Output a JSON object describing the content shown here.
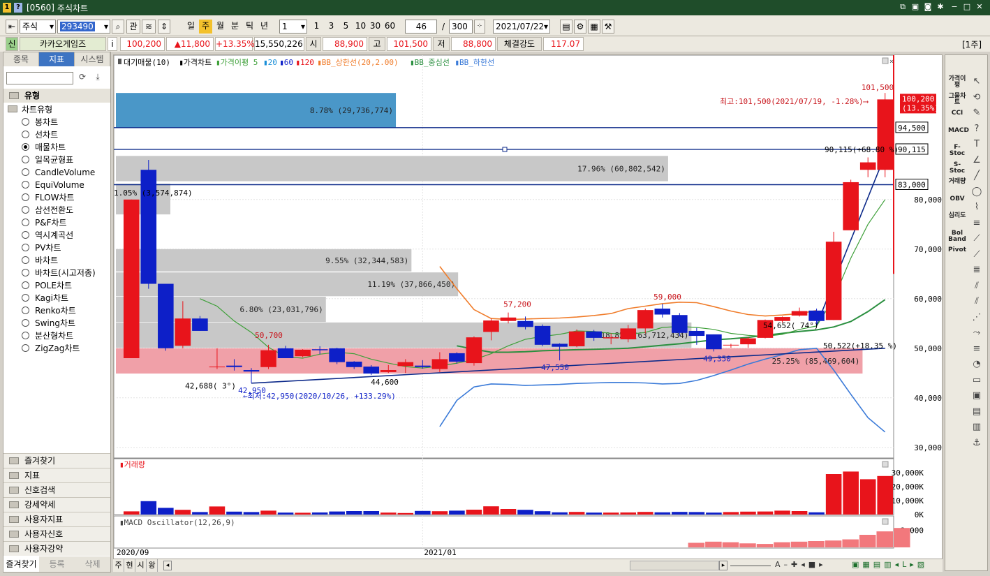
{
  "window": {
    "code": "[0560]",
    "title": "주식차트",
    "icon1": "1",
    "icon2": "?"
  },
  "toolbar": {
    "market": "주식",
    "code": "293490",
    "btn_gwan": "관",
    "periods": [
      "일",
      "주",
      "월",
      "분",
      "틱",
      "년"
    ],
    "active_period": "주",
    "interval": "1",
    "quick": [
      "1",
      "3",
      "5",
      "10",
      "30",
      "60"
    ],
    "count": "46",
    "total": "300",
    "date": "2021/07/22"
  },
  "infobar": {
    "badge": "신",
    "name": "카카오게임즈",
    "i": "i",
    "price": "100,200",
    "change": "▲11,800",
    "rate": "+13.35%",
    "volume": "15,550,226",
    "open_label": "시",
    "open": "88,900",
    "high_label": "고",
    "high": "101,500",
    "low_label": "저",
    "low": "88,800",
    "strength_label": "체결강도",
    "strength": "117.07",
    "unit": "[1주]"
  },
  "left": {
    "tabs": [
      "종목",
      "지표",
      "시스템"
    ],
    "active_tab": "지표",
    "section": "유형",
    "tree_root": "차트유형",
    "items": [
      "봉차트",
      "선차트",
      "매물차트",
      "일목균형표",
      "CandleVolume",
      "EquiVolume",
      "FLOW차트",
      "삼선전환도",
      "P&F차트",
      "역시계곡선",
      "PV차트",
      "바차트",
      "바차트(시고저종)",
      "POLE차트",
      "Kagi차트",
      "Renko차트",
      "Swing차트",
      "분산형차트",
      "ZigZag차트"
    ],
    "selected": "매물차트",
    "menus": [
      "즐겨찾기",
      "지표",
      "신호검색",
      "강세약세",
      "사용자지표",
      "사용자신호",
      "사용자강약"
    ],
    "bottom_tabs": [
      "즐겨찾기",
      "등록",
      "삭제"
    ]
  },
  "right_tools": [
    "가격이평",
    "그물차트",
    "CCI",
    "MACD",
    "F-Stoc",
    "S-Stoc",
    "거래량",
    "OBV",
    "심리도",
    "Bol Band",
    "Pivot"
  ],
  "bottom": {
    "tabs": [
      "주",
      "현",
      "시",
      "왕"
    ]
  },
  "colors": {
    "up": "#e8141b",
    "down": "#0d1fc8",
    "ma5": "#3fa03a",
    "ma20": "#2a8f3f",
    "bb_upper": "#f07c2a",
    "bb_lower": "#3a7ad8",
    "trend": "#0d2a8a"
  },
  "chart_data": {
    "type": "candlestick",
    "legend": [
      {
        "label": "대기매물(10)",
        "color": "#000"
      },
      {
        "label": "가격차트",
        "color": "#000"
      },
      {
        "label": "가격이평 5",
        "color": "#3fa03a"
      },
      {
        "label": "20",
        "color": "#1a8fd8"
      },
      {
        "label": "60",
        "color": "#0d1fc8"
      },
      {
        "label": "120",
        "color": "#e8141b"
      },
      {
        "label": "BB_상한선(20,2.00)",
        "color": "#f07c2a"
      },
      {
        "label": "BB_중심선",
        "color": "#2a8f3f"
      },
      {
        "label": "BB_하한선",
        "color": "#3a7ad8"
      }
    ],
    "y_ticks": [
      "80,000",
      "70,000",
      "60,000",
      "50,000",
      "40,000",
      "30,000"
    ],
    "y_tick_values": [
      80000,
      70000,
      60000,
      50000,
      40000,
      30000
    ],
    "ylim": [
      28000,
      108000
    ],
    "x_labels": [
      "2020/09",
      "2021/01"
    ],
    "candles": [
      {
        "o": 48000,
        "h": 80000,
        "l": 48000,
        "c": 80000
      },
      {
        "o": 86000,
        "h": 88000,
        "l": 62000,
        "c": 63000
      },
      {
        "o": 63000,
        "h": 63000,
        "l": 49500,
        "c": 50000
      },
      {
        "o": 50500,
        "h": 59500,
        "l": 50000,
        "c": 56000
      },
      {
        "o": 56000,
        "h": 56500,
        "l": 53500,
        "c": 53500
      },
      {
        "o": 46200,
        "h": 50000,
        "l": 45800,
        "c": 46300
      },
      {
        "o": 46500,
        "h": 47800,
        "l": 45500,
        "c": 46200
      },
      {
        "o": 45600,
        "h": 46000,
        "l": 43000,
        "c": 45300
      },
      {
        "o": 46200,
        "h": 50700,
        "l": 45800,
        "c": 49600
      },
      {
        "o": 50000,
        "h": 50500,
        "l": 48000,
        "c": 48000
      },
      {
        "o": 48400,
        "h": 49800,
        "l": 48200,
        "c": 49700
      },
      {
        "o": 49800,
        "h": 50400,
        "l": 48800,
        "c": 49600
      },
      {
        "o": 50000,
        "h": 50100,
        "l": 46800,
        "c": 47200
      },
      {
        "o": 47300,
        "h": 47400,
        "l": 45800,
        "c": 46200
      },
      {
        "o": 46300,
        "h": 46600,
        "l": 44600,
        "c": 44900
      },
      {
        "o": 45200,
        "h": 46600,
        "l": 45000,
        "c": 45600
      },
      {
        "o": 46400,
        "h": 47800,
        "l": 45000,
        "c": 47200
      },
      {
        "o": 46500,
        "h": 47600,
        "l": 45900,
        "c": 46200
      },
      {
        "o": 45800,
        "h": 49200,
        "l": 45200,
        "c": 47800
      },
      {
        "o": 49000,
        "h": 49200,
        "l": 46900,
        "c": 47300
      },
      {
        "o": 47000,
        "h": 52400,
        "l": 46500,
        "c": 52200
      },
      {
        "o": 53300,
        "h": 56000,
        "l": 51600,
        "c": 55600
      },
      {
        "o": 55500,
        "h": 57200,
        "l": 55000,
        "c": 56200
      },
      {
        "o": 55500,
        "h": 56400,
        "l": 53800,
        "c": 54300
      },
      {
        "o": 54500,
        "h": 54800,
        "l": 50400,
        "c": 50700
      },
      {
        "o": 50900,
        "h": 51000,
        "l": 47550,
        "c": 50300
      },
      {
        "o": 50400,
        "h": 53800,
        "l": 50200,
        "c": 53400
      },
      {
        "o": 53400,
        "h": 53700,
        "l": 51500,
        "c": 52100
      },
      {
        "o": 52000,
        "h": 53000,
        "l": 50800,
        "c": 52200
      },
      {
        "o": 51800,
        "h": 54700,
        "l": 51200,
        "c": 54000
      },
      {
        "o": 54000,
        "h": 58000,
        "l": 53000,
        "c": 57700
      },
      {
        "o": 58000,
        "h": 59000,
        "l": 56200,
        "c": 56800
      },
      {
        "o": 56700,
        "h": 57100,
        "l": 52500,
        "c": 53100
      },
      {
        "o": 53500,
        "h": 54100,
        "l": 50700,
        "c": 52500
      },
      {
        "o": 52800,
        "h": 52800,
        "l": 49350,
        "c": 49800
      },
      {
        "o": 50600,
        "h": 50900,
        "l": 50100,
        "c": 50700
      },
      {
        "o": 50800,
        "h": 52300,
        "l": 50100,
        "c": 52000
      },
      {
        "o": 52100,
        "h": 55800,
        "l": 52000,
        "c": 55700
      },
      {
        "o": 55500,
        "h": 56400,
        "l": 55200,
        "c": 56300
      },
      {
        "o": 56600,
        "h": 58200,
        "l": 56400,
        "c": 57500
      },
      {
        "o": 57600,
        "h": 58000,
        "l": 54652,
        "c": 55500
      },
      {
        "o": 55700,
        "h": 73500,
        "l": 55700,
        "c": 71500
      },
      {
        "o": 73800,
        "h": 84000,
        "l": 74300,
        "c": 83500
      },
      {
        "o": 86000,
        "h": 88500,
        "l": 84500,
        "c": 87500
      },
      {
        "o": 86000,
        "h": 101500,
        "l": 84500,
        "c": 100200
      }
    ],
    "volume_ticks": [
      "30,000K",
      "20,000K",
      "10,000K",
      "0K"
    ],
    "volume_tick_values": [
      30000,
      20000,
      10000,
      0
    ],
    "volume_ylim": [
      0,
      37000
    ],
    "volume": [
      2300,
      9600,
      4800,
      3400,
      1800,
      5800,
      2100,
      1800,
      2800,
      1400,
      1300,
      1500,
      2200,
      2500,
      2500,
      1400,
      1100,
      2600,
      2400,
      2800,
      3500,
      5900,
      4000,
      3400,
      2400,
      1600,
      1900,
      1400,
      1400,
      1500,
      1900,
      1600,
      1900,
      1800,
      1400,
      1800,
      2100,
      2200,
      2800,
      2500,
      1600,
      29000,
      30800,
      25300,
      27600
    ],
    "macd_label": "MACD Oscillator(12,26,9)",
    "macd_tick": "3,000",
    "macd_tick_value": 3000,
    "macd_ylim": [
      0,
      5500
    ],
    "macd_start_index": 33,
    "macd": [
      800,
      1000,
      900,
      700,
      600,
      900,
      1000,
      1100,
      1200,
      1400,
      2200,
      2800,
      3400
    ],
    "volume_label": "거래량",
    "ma5": [
      null,
      null,
      null,
      null,
      60000,
      58500,
      55500,
      53200,
      50200,
      48300,
      48000,
      48800,
      49200,
      48900,
      47800,
      47000,
      46300,
      46000,
      46400,
      47000,
      47700,
      48900,
      50500,
      51800,
      52400,
      52800,
      53500,
      53400,
      53000,
      52800,
      53200,
      54200,
      54400,
      54200,
      53800,
      53000,
      52600,
      52400,
      52800,
      53800,
      54500,
      60000,
      68200,
      75000,
      80000
    ],
    "ma20": [
      null,
      null,
      null,
      null,
      null,
      null,
      null,
      null,
      null,
      null,
      null,
      null,
      null,
      null,
      null,
      null,
      null,
      null,
      null,
      50500,
      49800,
      49200,
      49200,
      49300,
      49500,
      49600,
      49700,
      49800,
      49900,
      50000,
      50300,
      50600,
      50900,
      51300,
      51700,
      51900,
      52200,
      52600,
      53000,
      53400,
      53700,
      54300,
      55400,
      57400,
      59800
    ],
    "bb_upper": [
      null,
      null,
      null,
      null,
      null,
      null,
      null,
      null,
      null,
      null,
      null,
      null,
      null,
      null,
      null,
      null,
      null,
      null,
      66500,
      62000,
      57800,
      56000,
      55800,
      55900,
      56000,
      56100,
      56300,
      56600,
      57000,
      58000,
      58500,
      59000,
      59300,
      59200,
      58400,
      57500,
      56800,
      56500,
      56700,
      57000,
      57600,
      null,
      null,
      null,
      null
    ],
    "bb_lower": [
      null,
      null,
      null,
      null,
      null,
      null,
      null,
      null,
      null,
      null,
      null,
      null,
      null,
      null,
      null,
      null,
      null,
      null,
      34200,
      39500,
      42200,
      42800,
      42700,
      42500,
      42600,
      42700,
      42900,
      43000,
      43100,
      43100,
      43000,
      42800,
      42900,
      43500,
      44500,
      45600,
      46800,
      47800,
      48700,
      49700,
      50000,
      45600,
      40700,
      36000,
      33100
    ],
    "volume_profile": [
      {
        "from": 94500,
        "to": 101500,
        "label": "8.78% (29,736,774)",
        "len": 0.36,
        "color": "#4a97c8"
      },
      {
        "from": 83700,
        "to": 88800,
        "label": "17.96% (60,802,542)",
        "len": 0.71,
        "color": "#c8c8c8"
      },
      {
        "from": 77000,
        "to": 83200,
        "label": "",
        "len": 0.07,
        "color": "#c8c8c8"
      },
      {
        "from": 70300,
        "to": 76800,
        "label": "",
        "len": 0.0,
        "color": "#c8c8c8"
      },
      {
        "from": 65500,
        "to": 70000,
        "label": "9.55% (32,344,583)",
        "len": 0.38,
        "color": "#c8c8c8"
      },
      {
        "from": 60500,
        "to": 65300,
        "label": "11.19% (37,866,450)",
        "len": 0.44,
        "color": "#c8c8c8"
      },
      {
        "from": 55300,
        "to": 60400,
        "label": "6.80% (23,031,796)",
        "len": 0.27,
        "color": "#c8c8c8"
      },
      {
        "from": 50100,
        "to": 55200,
        "label": "18.82% (63,712,434)",
        "len": 0.74,
        "color": "#c8c8c8"
      },
      {
        "from": 44900,
        "to": 50000,
        "label": "25.25% (85,469,604)",
        "len": 0.96,
        "color": "#f0a0a8"
      }
    ],
    "hlines": [
      {
        "value": 94500,
        "label": "94,500"
      },
      {
        "value": 90115,
        "label": "90,115"
      },
      {
        "value": 83000,
        "label": "83,000"
      }
    ],
    "current": {
      "value": 100200,
      "label": "100,200",
      "rate": "(13.35%)"
    },
    "annotations": [
      {
        "text": "최고:101,500(2021/07/19, -1.28%)⟶",
        "color": "#c8141b"
      },
      {
        "text": "101,500",
        "color": "#c8141b"
      },
      {
        "text": "←최저:42,950(2020/10/26, +133.29%)",
        "color": "#0d1fc8"
      },
      {
        "text": "42,950",
        "color": "#0d1fc8"
      },
      {
        "text": "42,688(  3°)",
        "color": "#000"
      },
      {
        "text": "50,700",
        "color": "#c8141b"
      },
      {
        "text": "44,600",
        "color": "#000"
      },
      {
        "text": "57,200",
        "color": "#c8141b"
      },
      {
        "text": "47,550",
        "color": "#0d1fc8"
      },
      {
        "text": "59,000",
        "color": "#c8141b"
      },
      {
        "text": "49,350",
        "color": "#0d1fc8"
      },
      {
        "text": "54,652( 74°)",
        "color": "#000"
      },
      {
        "text": "50,522(+18.35 %)",
        "color": "#000"
      },
      {
        "text": "90,115(+68.80 %)",
        "color": "#000"
      },
      {
        "text": "1.05% (3,574,874)",
        "color": "#000"
      }
    ]
  }
}
